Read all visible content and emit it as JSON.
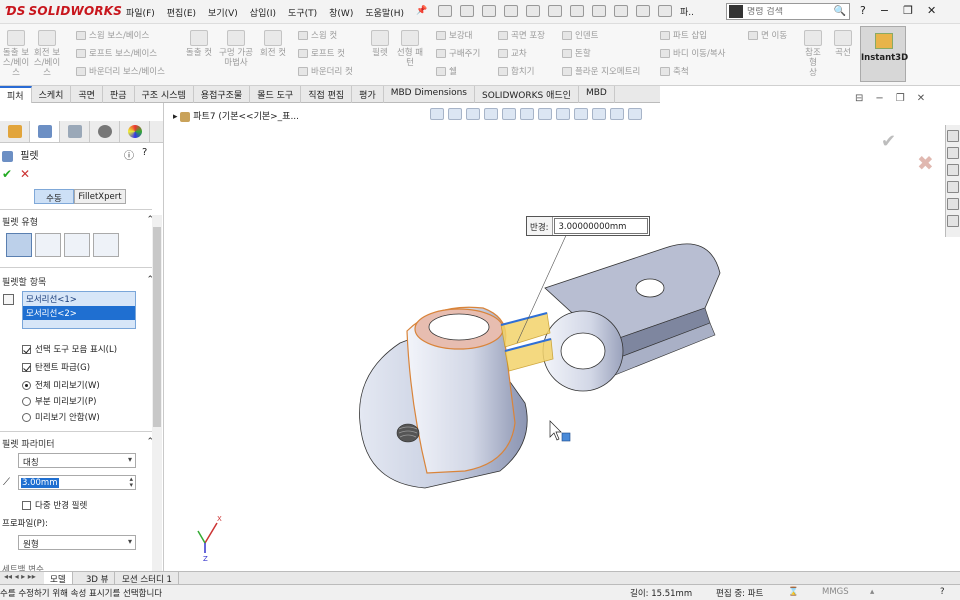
{
  "app": {
    "logo": "SOLIDWORKS",
    "menus": [
      "파일(F)",
      "편집(E)",
      "보기(V)",
      "삽입(I)",
      "도구(T)",
      "창(W)",
      "도움말(H)"
    ],
    "short_label": "파..",
    "search_placeholder": "명령 검색"
  },
  "ribbon": {
    "col1": [
      "돌출 보",
      "스/베이",
      "스"
    ],
    "col2": [
      "회전 보",
      "스/베이",
      "스"
    ],
    "row_items": [
      "스윕 보스/베이스",
      "로프트 보스/베이스",
      "바운더리 보스/베이스"
    ],
    "cut1": [
      "돌출 컷"
    ],
    "cut2": [
      "구멍 가공",
      "마법사"
    ],
    "cut3": [
      "회전 컷"
    ],
    "cut_rows": [
      "스윕 컷",
      "로프트 컷",
      "바운더리 컷"
    ],
    "fillet": [
      "필렛"
    ],
    "pattern": [
      "선형 패",
      "턴"
    ],
    "feat_rows": [
      "보강대",
      "구배주기",
      "쉘"
    ],
    "feat_rows2": [
      "곡면 포장",
      "교차",
      "합치기"
    ],
    "feat_rows3": [
      "인덴트",
      "돈할",
      "플라운 지오메트리"
    ],
    "feat_rows4": [
      "파트 삽입",
      "바디 이동/복사",
      "축척"
    ],
    "feat_rows5": [
      "면 이동"
    ],
    "ref": [
      "참조 형",
      "상"
    ],
    "curves": [
      "곡선"
    ],
    "instant3d": "Instant3D"
  },
  "tabs": [
    "피처",
    "스케치",
    "곡면",
    "판금",
    "구조 시스템",
    "용접구조물",
    "몰드 도구",
    "직접 편집",
    "평가",
    "MBD Dimensions",
    "SOLIDWORKS 애드인",
    "MBD"
  ],
  "panel": {
    "title": "필렛",
    "manual_btn": "수동",
    "filletxpert_btn": "FilletXpert",
    "fillet_type_label": "필렛 유형",
    "items_label": "필렛할 항목",
    "edges": [
      "모서리선<1>",
      "모서리선<2>"
    ],
    "options": {
      "show_toolbar": "선택 도구 모음 표시(L)",
      "tangent": "탄젠트 파급(G)",
      "full_preview": "전체 미리보기(W)",
      "partial_preview": "부분 미리보기(P)",
      "no_preview": "미리보기 안함(W)"
    },
    "params_label": "필렛 파라미터",
    "param_type": "대칭",
    "radius": "3.00mm",
    "multi_radius": "다중 반경 필렛",
    "profile_label": "프로파일(P):",
    "profile": "원형",
    "next_section": "세트백 변수"
  },
  "viewport": {
    "breadcrumb": "파트7 (기본<<기본>_표...",
    "radius_label": "반경:",
    "radius_value": "3.00000000mm"
  },
  "bottom_tabs": [
    "모델",
    "3D 뷰",
    "모션 스터디 1"
  ],
  "status": {
    "message": "수를 수정하기 위해 속성 표시기를 선택합니다",
    "length": "길이: 15.51mm",
    "editing": "편집 중: 파트",
    "units": "MMGS"
  }
}
